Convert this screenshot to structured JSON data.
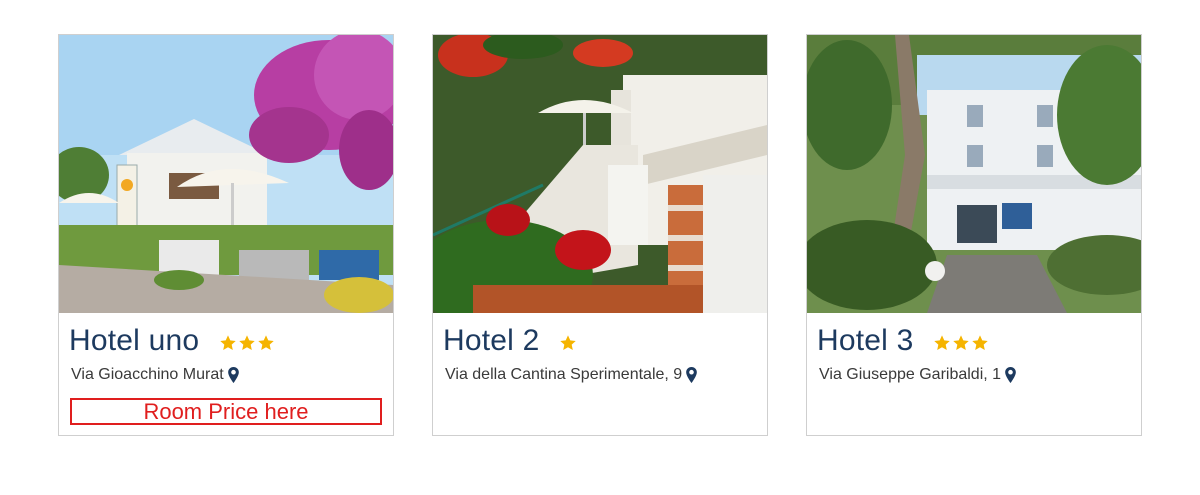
{
  "hotels": [
    {
      "name": "Hotel uno",
      "stars": 3,
      "address": "Via Gioacchino Murat",
      "price_placeholder": "Room Price here"
    },
    {
      "name": "Hotel 2",
      "stars": 1,
      "address": "Via della Cantina Sperimentale, 9"
    },
    {
      "name": "Hotel 3",
      "stars": 3,
      "address": "Via Giuseppe Garibaldi, 1"
    }
  ],
  "colors": {
    "title": "#1d3a5f",
    "star": "#f5b400",
    "price_highlight": "#e01e1e",
    "border": "#cfcfcf"
  },
  "icons": {
    "rating": "star-icon",
    "location": "map-pin-icon"
  }
}
